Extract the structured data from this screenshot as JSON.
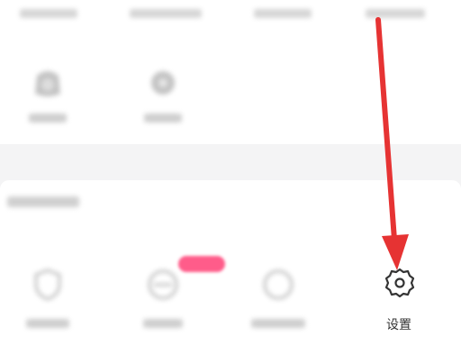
{
  "settings_item": {
    "label": "设置",
    "icon": "gear-icon"
  },
  "annotation": {
    "color": "#e63333"
  }
}
